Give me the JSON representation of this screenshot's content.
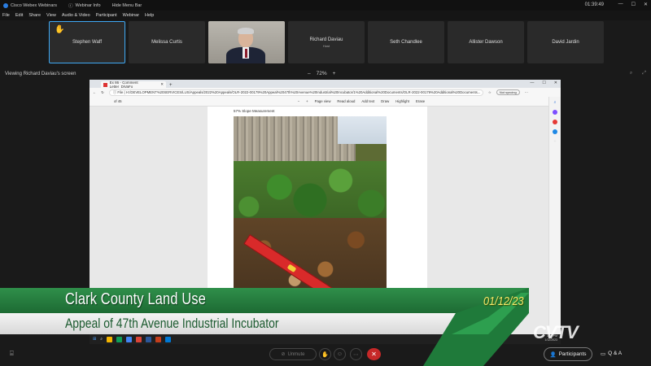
{
  "titlebar": {
    "app": "Cisco Webex Webinars",
    "info": "Webinar Info",
    "hide_menu": "Hide Menu Bar",
    "clock": "01:39:49"
  },
  "menubar": [
    "File",
    "Edit",
    "Share",
    "View",
    "Audio & Video",
    "Participant",
    "Webinar",
    "Help"
  ],
  "participants": [
    {
      "name": "Stephen Waff",
      "role": "",
      "hand": true,
      "active": true
    },
    {
      "name": "Melissa Curtis",
      "role": ""
    },
    {
      "name": "",
      "role": "",
      "video": true
    },
    {
      "name": "Richard Daviau",
      "role": "Host"
    },
    {
      "name": "Seth Chandlee",
      "role": ""
    },
    {
      "name": "Allister Dawson",
      "role": ""
    },
    {
      "name": "David Jardin",
      "role": ""
    }
  ],
  "viewbar": {
    "label": "Viewing Richard Daviau's screen",
    "zoom_minus": "–",
    "zoom": "72%",
    "zoom_plus": "+"
  },
  "browser": {
    "tab_title": "Ex 86 - Comment Letter_DiVaFo",
    "tab_plus": "+",
    "url_prefix": "File",
    "url": "H:/DEVELOPMENT%20SERVICES/LUS/Appeals/2022%20Appeals/OLR-2022-00179%20Appeal%2047th%20Avenue%20Industrial%20Incubator/1%20Additional%20Documents/OLR-2022-00179%20Additional%20Documents...",
    "signin": "Not syncing",
    "page_count": "of 45",
    "tools": [
      "Page view",
      "Read aloud",
      "Add text",
      "Draw",
      "Highlight",
      "Erase"
    ],
    "page_heading": "57% Slope Measurement"
  },
  "taskbar": {
    "time": "1:39 PM",
    "date": "1/12/2023"
  },
  "lower_third": {
    "title": "Clark County Land Use",
    "subtitle": "Appeal of 47th Avenue Industrial Incubator",
    "date": "01/12/23",
    "watermark": "CVTV"
  },
  "controls": {
    "unmute": "Unmute",
    "participants": "Participants",
    "qa": "Q & A"
  },
  "colors": {
    "accent_green": "#2f8f4a",
    "date_yellow": "#f5e86a",
    "active_border": "#3fa9f5",
    "end_call": "#c62828"
  }
}
